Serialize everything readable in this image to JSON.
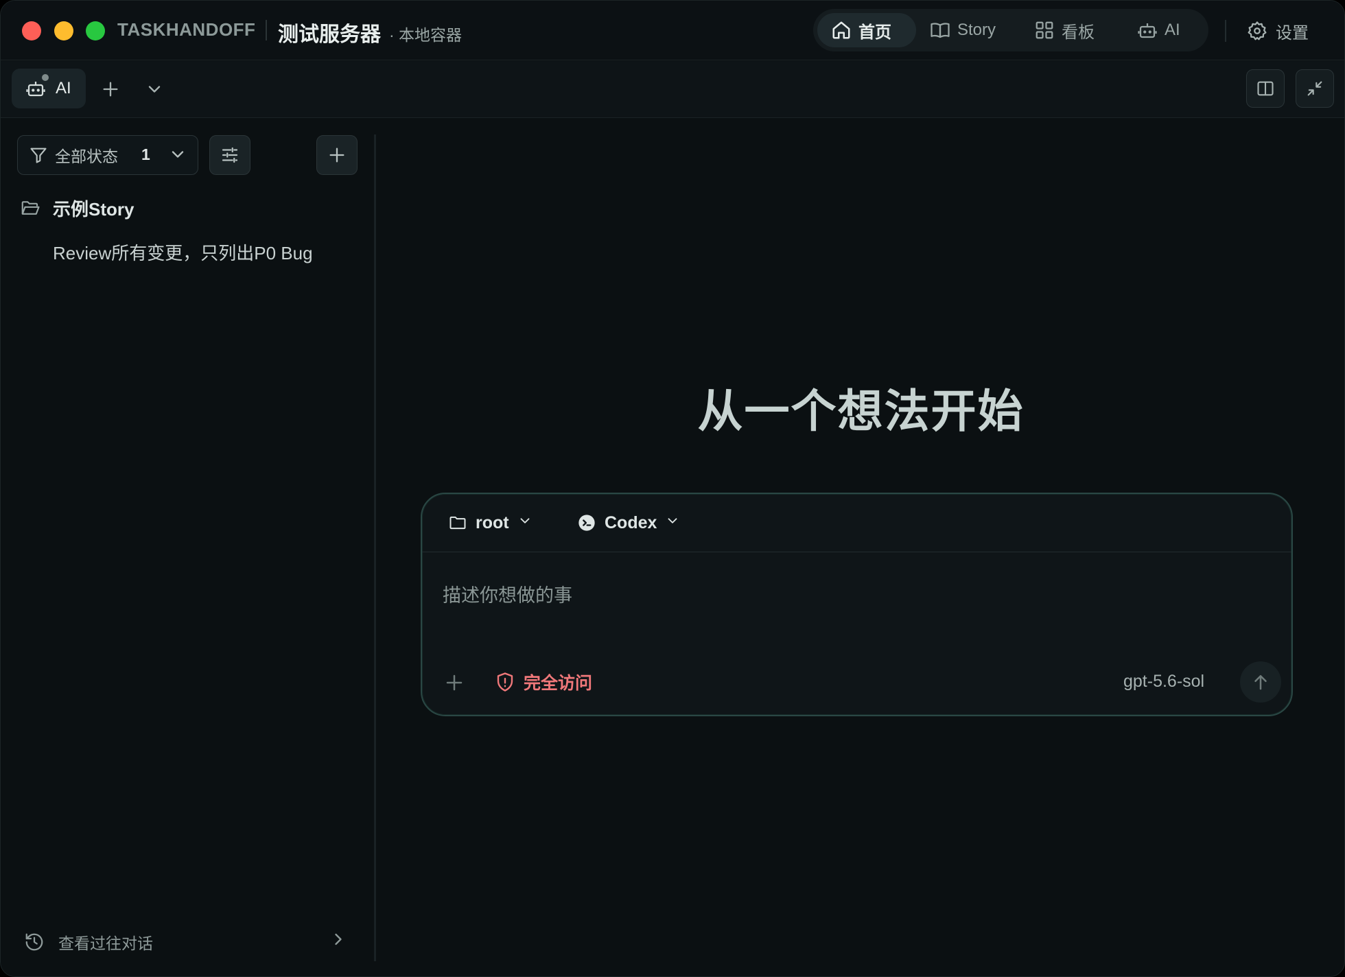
{
  "titlebar": {
    "brand": "TASKHANDOFF",
    "server_name": "测试服务器",
    "server_sub": "· 本地容器",
    "nav": {
      "home": "首页",
      "story": "Story",
      "board": "看板",
      "ai": "AI"
    },
    "settings": "设置"
  },
  "tabbar": {
    "ai_tab": "AI"
  },
  "sidebar": {
    "filter_label": "全部状态",
    "filter_count": "1",
    "group_name": "示例Story",
    "items": [
      {
        "label": "Review所有变更，只列出P0 Bug"
      }
    ],
    "history_label": "查看过往对话"
  },
  "main": {
    "hero_title": "从一个想法开始",
    "composer": {
      "folder": "root",
      "agent": "Codex",
      "placeholder": "描述你想做的事",
      "access_label": "完全访问",
      "model": "gpt-5.6-sol"
    }
  },
  "colors": {
    "background": "#0b1012",
    "accent_border": "#2a4744",
    "danger": "#f0787a"
  },
  "icons": {
    "home": "home-icon",
    "story": "book-icon",
    "board": "grid-icon",
    "ai": "bot-icon",
    "settings": "gear-icon",
    "filter": "filter-icon",
    "tune": "sliders-icon",
    "add": "plus-icon",
    "folder": "folder-icon",
    "history": "history-icon",
    "codex": "codex-icon",
    "access": "shield-icon",
    "send": "arrow-up-icon"
  }
}
